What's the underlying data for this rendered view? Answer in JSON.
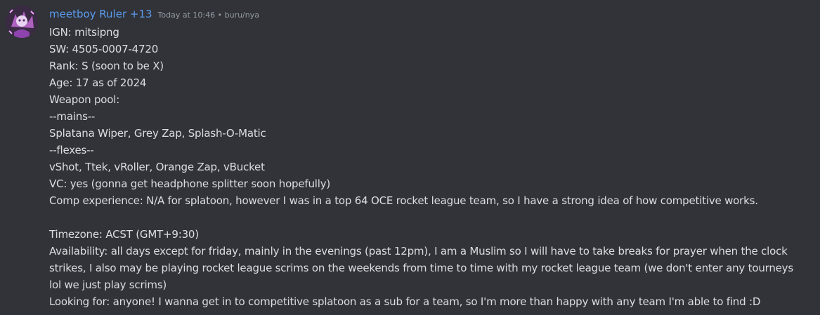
{
  "message": {
    "author": "meetboy Ruler +13",
    "timestamp": "Today at 10:46 • buru/nya",
    "author_color": "#5b9bef",
    "lines": [
      "IGN: mitsipng",
      "SW: 4505-0007-4720",
      "Rank: S (soon to be X)",
      "Age: 17 as of 2024",
      "Weapon pool:",
      "--mains--",
      "Splatana Wiper, Grey Zap, Splash-O-Matic",
      "--flexes--",
      "vShot, Ttek, vRoller, Orange Zap, vBucket",
      "VC: yes (gonna get headphone splitter soon hopefully)",
      "Comp experience: N/A for splatoon, however I was in a top 64 OCE rocket league team, so I have a strong idea of how competitive works.",
      "",
      "Timezone: ACST (GMT+9:30)",
      "Availability: all days except for friday, mainly in the evenings (past 12pm), I am a Muslim so I will have to take breaks for prayer when the clock strikes, I also may be playing rocket league scrims on the weekends from time to time with my rocket league team (we don't enter any tourneys lol we just play scrims)",
      "Looking for: anyone! I wanna get in to competitive splatoon as a sub for a team, so I'm more than happy with any team I'm able to find :D"
    ]
  },
  "theme": {
    "background": "#313338",
    "text": "#dbdee1",
    "muted": "#949ba4"
  }
}
